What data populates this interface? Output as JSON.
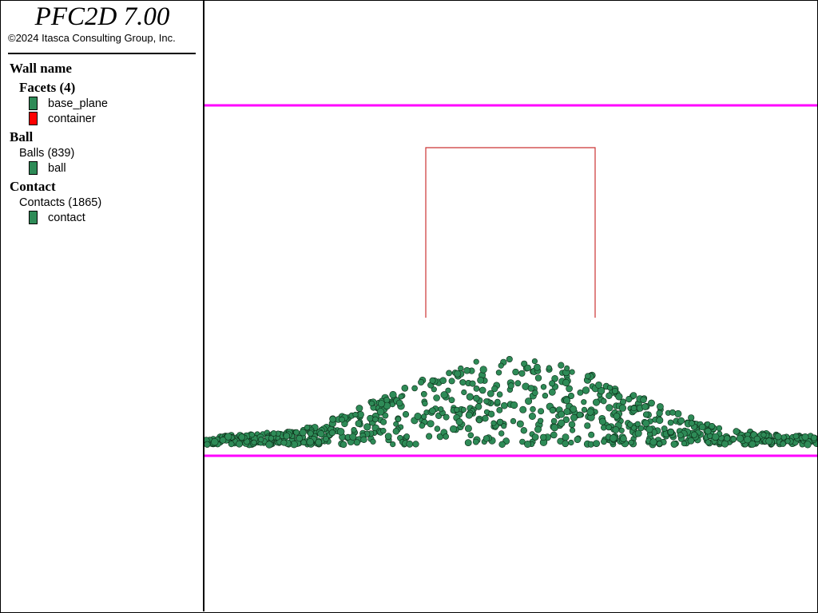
{
  "app": {
    "title": "PFC2D 7.00",
    "copyright": "©2024 Itasca Consulting Group, Inc."
  },
  "legend": {
    "wall_heading": "Wall name",
    "facets_heading": "Facets (4)",
    "facets": [
      {
        "label": "base_plane",
        "color": "#2e8b57"
      },
      {
        "label": "container",
        "color": "#ff0000"
      }
    ],
    "ball_heading": "Ball",
    "balls_heading": "Balls (839)",
    "balls": [
      {
        "label": "ball",
        "color": "#2e8b57"
      }
    ],
    "contact_heading": "Contact",
    "contacts_heading": "Contacts (1865)",
    "contacts": [
      {
        "label": "contact",
        "color": "#2e8b57"
      }
    ]
  },
  "colors": {
    "base_plane_line": "#ff00ff",
    "container_line": "#cc3333",
    "ball_fill": "#2e8b57",
    "ball_outline": "#0b2a16"
  },
  "simulation": {
    "ball_count": 839,
    "contact_count": 1865
  }
}
